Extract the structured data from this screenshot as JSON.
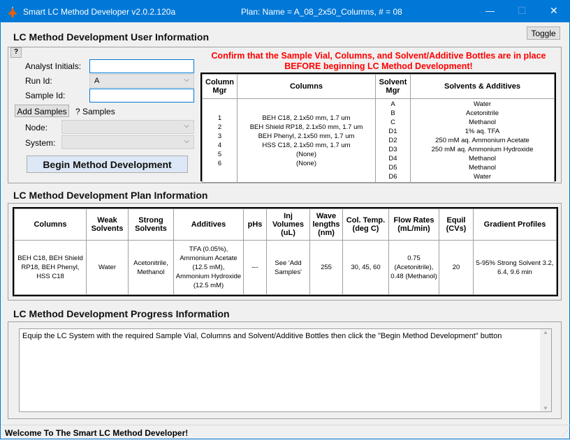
{
  "window": {
    "title": "Smart LC Method Developer v2.0.2.120a",
    "plan": "Plan:  Name = A_08_2x50_Columns, # = 08",
    "minimize": "—",
    "maximize": "☐",
    "close": "✕"
  },
  "user_info": {
    "heading": "LC Method Development User Information",
    "toggle": "Toggle",
    "help": "?",
    "analyst_label": "Analyst Initials:",
    "analyst_value": "",
    "run_label": "Run Id:",
    "run_value": "A",
    "sample_label": "Sample Id:",
    "sample_value": "",
    "add_samples": "Add Samples",
    "samples_count": "? Samples",
    "node_label": "Node:",
    "node_value": "",
    "system_label": "System:",
    "system_value": "",
    "begin": "Begin Method Development",
    "warning": "Confirm that the Sample Vial, Columns, and Solvent/Additive Bottles are in place BEFORE beginning LC Method Development!",
    "warning_color": "#ff0000",
    "setup_table": {
      "headers": [
        "Column Mgr",
        "Columns",
        "Solvent Mgr",
        "Solvents & Additives"
      ],
      "column_ids": [
        "1",
        "2",
        "3",
        "4",
        "5",
        "6"
      ],
      "columns": [
        "BEH C18, 2.1x50 mm, 1.7 um",
        "BEH Shield RP18, 2.1x50 mm, 1.7 um",
        "BEH Phenyl, 2.1x50 mm, 1.7 um",
        "HSS C18, 2.1x50 mm, 1.7 um",
        "(None)",
        "(None)"
      ],
      "solvent_ids": [
        "A",
        "B",
        "C",
        "D1",
        "D2",
        "D3",
        "D4",
        "D5",
        "D6"
      ],
      "solvents": [
        "Water",
        "Acetonitrile",
        "Methanol",
        "1% aq. TFA",
        "250 mM aq. Ammonium Acetate",
        "250 mM aq. Ammonium Hydroxide",
        "Methanol",
        "Methanol",
        "Water"
      ]
    }
  },
  "plan_info": {
    "heading": "LC Method Development Plan Information",
    "headers": [
      "Columns",
      "Weak Solvents",
      "Strong Solvents",
      "Additives",
      "pHs",
      "Inj Volumes (uL)",
      "Wave lengths (nm)",
      "Col. Temp. (deg C)",
      "Flow Rates (mL/min)",
      "Equil (CVs)",
      "Gradient Profiles"
    ],
    "row": [
      "BEH C18, BEH Shield RP18, BEH Phenyl, HSS C18",
      "Water",
      "Acetonitrile, Methanol",
      "TFA (0.05%), Ammonium Acetate (12.5 mM), Ammonium Hydroxide (12.5 mM)",
      "---",
      "See 'Add Samples'",
      "255",
      "30, 45, 60",
      "0.75 (Acetonitrile), 0.48 (Methanol)",
      "20",
      "5-95% Strong Solvent 3.2, 6.4, 9.6 min"
    ]
  },
  "progress": {
    "heading": "LC Method Development Progress Information",
    "text": "Equip the LC System with the required Sample Vial, Columns and Solvent/Additive Bottles then click the \"Begin Method Development\" button"
  },
  "status": "Welcome To The Smart LC Method Developer!"
}
